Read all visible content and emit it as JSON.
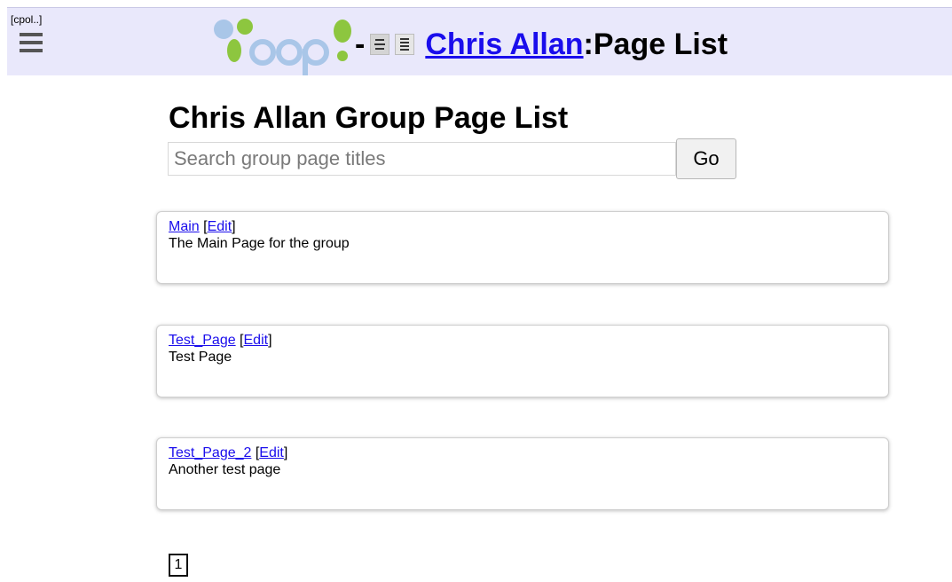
{
  "header": {
    "cpol_label": "[cpol..]",
    "separator": "-",
    "group_link": "Chris Allan",
    "page_suffix": ":Page List",
    "logo_text": "Yoop"
  },
  "main": {
    "heading": "Chris Allan Group Page List",
    "search_placeholder": "Search group page titles",
    "search_value": "",
    "go_label": "Go",
    "pages": [
      {
        "title": "Main",
        "edit": "Edit",
        "description": "The Main Page for the group"
      },
      {
        "title": "Test_Page",
        "edit": "Edit",
        "description": "Test Page"
      },
      {
        "title": "Test_Page_2",
        "edit": "Edit",
        "description": "Another test page"
      }
    ],
    "pagination": {
      "current": "1"
    }
  },
  "colors": {
    "header_bg": "#e9e8fb",
    "link": "#1a0dec",
    "logo_green": "#8dc63f",
    "logo_blue": "#a9c6e8"
  }
}
